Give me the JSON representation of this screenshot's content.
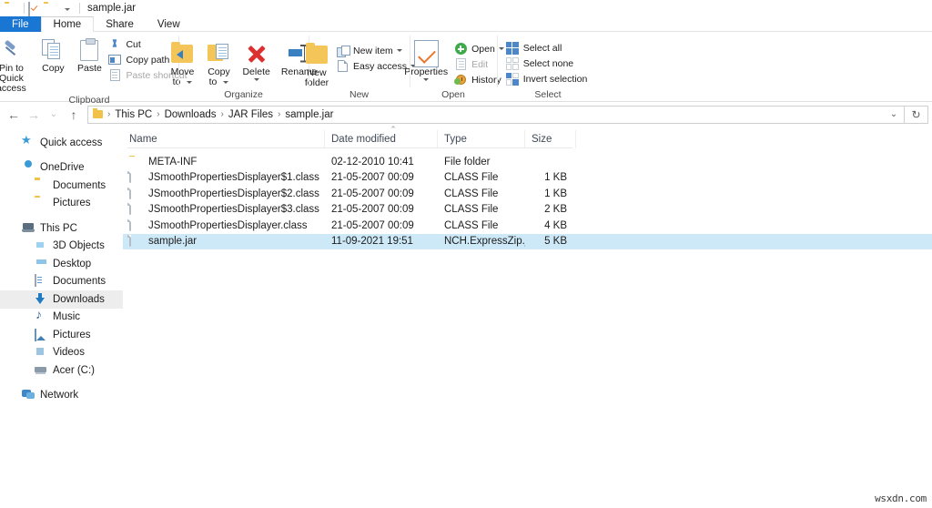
{
  "window": {
    "title": "sample.jar",
    "quick_access_icons": [
      "folder-icon",
      "properties-icon",
      "new-folder-icon",
      "customize-caret-icon"
    ]
  },
  "ribbon": {
    "tabs": [
      {
        "label": "File",
        "state": "file"
      },
      {
        "label": "Home",
        "state": "active"
      },
      {
        "label": "Share",
        "state": "normal"
      },
      {
        "label": "View",
        "state": "normal"
      }
    ],
    "groups": [
      {
        "name": "Clipboard",
        "label": "Clipboard",
        "big_buttons": [
          {
            "label": "Pin to Quick\naccess",
            "line1": "Pin to Quick",
            "line2": "access",
            "icon": "pin-icon"
          },
          {
            "label": "Copy",
            "line1": "Copy",
            "line2": "",
            "icon": "copy-icon"
          },
          {
            "label": "Paste",
            "line1": "Paste",
            "line2": "",
            "icon": "paste-icon"
          }
        ],
        "small_buttons": [
          {
            "label": "Cut",
            "icon": "scissors-icon",
            "disabled": false
          },
          {
            "label": "Copy path",
            "icon": "copy-path-icon",
            "disabled": false
          },
          {
            "label": "Paste shortcut",
            "icon": "paste-shortcut-icon",
            "disabled": true
          }
        ]
      },
      {
        "name": "Organize",
        "label": "Organize",
        "big_buttons": [
          {
            "line1": "Move",
            "line2": "to",
            "icon": "move-to-icon",
            "dropdown": true
          },
          {
            "line1": "Copy",
            "line2": "to",
            "icon": "copy-to-icon",
            "dropdown": true
          },
          {
            "line1": "Delete",
            "line2": "",
            "icon": "delete-icon",
            "dropdown": true
          },
          {
            "line1": "Rename",
            "line2": "",
            "icon": "rename-icon",
            "dropdown": false
          }
        ],
        "small_buttons": []
      },
      {
        "name": "New",
        "label": "New",
        "big_buttons": [
          {
            "line1": "New",
            "line2": "folder",
            "icon": "new-folder-icon",
            "dropdown": false
          }
        ],
        "small_buttons": [
          {
            "label": "New item",
            "icon": "new-item-icon",
            "dropdown": true,
            "disabled": false
          },
          {
            "label": "Easy access",
            "icon": "easy-access-icon",
            "dropdown": true,
            "disabled": false
          }
        ]
      },
      {
        "name": "Open",
        "label": "Open",
        "big_buttons": [
          {
            "line1": "Properties",
            "line2": "",
            "icon": "properties-icon",
            "dropdown": true
          }
        ],
        "small_buttons": [
          {
            "label": "Open",
            "icon": "open-icon",
            "dropdown": true,
            "disabled": false
          },
          {
            "label": "Edit",
            "icon": "edit-icon",
            "dropdown": false,
            "disabled": true
          },
          {
            "label": "History",
            "icon": "history-icon",
            "dropdown": false,
            "disabled": false
          }
        ]
      },
      {
        "name": "Select",
        "label": "Select",
        "big_buttons": [],
        "small_buttons": [
          {
            "label": "Select all",
            "icon": "select-all-icon",
            "disabled": false
          },
          {
            "label": "Select none",
            "icon": "select-none-icon",
            "disabled": false
          },
          {
            "label": "Invert selection",
            "icon": "invert-selection-icon",
            "disabled": false
          }
        ]
      }
    ]
  },
  "address": {
    "back_icon": "arrow-left-icon",
    "forward_icon": "arrow-right-icon",
    "recent_icon": "chevron-down-icon",
    "up_icon": "arrow-up-icon",
    "breadcrumbs": [
      "This PC",
      "Downloads",
      "JAR Files",
      "sample.jar"
    ],
    "separator": "›",
    "dropdown_icon": "chevron-down-icon",
    "refresh_icon": "refresh-icon"
  },
  "sidebar": {
    "items": [
      {
        "label": "Quick access",
        "icon": "star-icon",
        "level": 1,
        "selected": false,
        "gap_after": true
      },
      {
        "label": "OneDrive",
        "icon": "cloud-icon",
        "level": 1,
        "selected": false,
        "gap_after": false
      },
      {
        "label": "Documents",
        "icon": "folder-icon",
        "level": 2,
        "selected": false,
        "gap_after": false
      },
      {
        "label": "Pictures",
        "icon": "folder-icon",
        "level": 2,
        "selected": false,
        "gap_after": true
      },
      {
        "label": "This PC",
        "icon": "this-pc-icon",
        "level": 1,
        "selected": false,
        "gap_after": false
      },
      {
        "label": "3D Objects",
        "icon": "3d-objects-icon",
        "level": 2,
        "selected": false,
        "gap_after": false
      },
      {
        "label": "Desktop",
        "icon": "desktop-icon",
        "level": 2,
        "selected": false,
        "gap_after": false
      },
      {
        "label": "Documents",
        "icon": "documents-icon",
        "level": 2,
        "selected": false,
        "gap_after": false
      },
      {
        "label": "Downloads",
        "icon": "downloads-icon",
        "level": 2,
        "selected": true,
        "gap_after": false
      },
      {
        "label": "Music",
        "icon": "music-icon",
        "level": 2,
        "selected": false,
        "gap_after": false
      },
      {
        "label": "Pictures",
        "icon": "pictures-icon",
        "level": 2,
        "selected": false,
        "gap_after": false
      },
      {
        "label": "Videos",
        "icon": "videos-icon",
        "level": 2,
        "selected": false,
        "gap_after": false
      },
      {
        "label": "Acer (C:)",
        "icon": "drive-icon",
        "level": 2,
        "selected": false,
        "gap_after": true
      },
      {
        "label": "Network",
        "icon": "network-icon",
        "level": 1,
        "selected": false,
        "gap_after": false
      }
    ]
  },
  "filelist": {
    "columns": [
      {
        "label": "Name",
        "sorted": true,
        "sort_direction": "ascending"
      },
      {
        "label": "Date modified",
        "sorted": false
      },
      {
        "label": "Type",
        "sorted": false
      },
      {
        "label": "Size",
        "sorted": false
      }
    ],
    "sort_caret": "⌃",
    "rows": [
      {
        "name": "META-INF",
        "date": "02-12-2010 10:41",
        "type": "File folder",
        "size": "",
        "icon": "folder-icon",
        "selected": false
      },
      {
        "name": "JSmoothPropertiesDisplayer$1.class",
        "date": "21-05-2007 00:09",
        "type": "CLASS File",
        "size": "1 KB",
        "icon": "file-icon",
        "selected": false
      },
      {
        "name": "JSmoothPropertiesDisplayer$2.class",
        "date": "21-05-2007 00:09",
        "type": "CLASS File",
        "size": "1 KB",
        "icon": "file-icon",
        "selected": false
      },
      {
        "name": "JSmoothPropertiesDisplayer$3.class",
        "date": "21-05-2007 00:09",
        "type": "CLASS File",
        "size": "2 KB",
        "icon": "file-icon",
        "selected": false
      },
      {
        "name": "JSmoothPropertiesDisplayer.class",
        "date": "21-05-2007 00:09",
        "type": "CLASS File",
        "size": "4 KB",
        "icon": "file-icon",
        "selected": false
      },
      {
        "name": "sample.jar",
        "date": "11-09-2021 19:51",
        "type": "NCH.ExpressZip.jar",
        "size": "5 KB",
        "icon": "file-icon",
        "selected": true
      }
    ]
  },
  "watermark": {
    "text": "wsxdn.com"
  },
  "colors": {
    "file_tab": "#1976d2",
    "selection": "#cde8f7",
    "sidebar_selection": "#ededed",
    "folder_yellow": "#f2c14a"
  }
}
